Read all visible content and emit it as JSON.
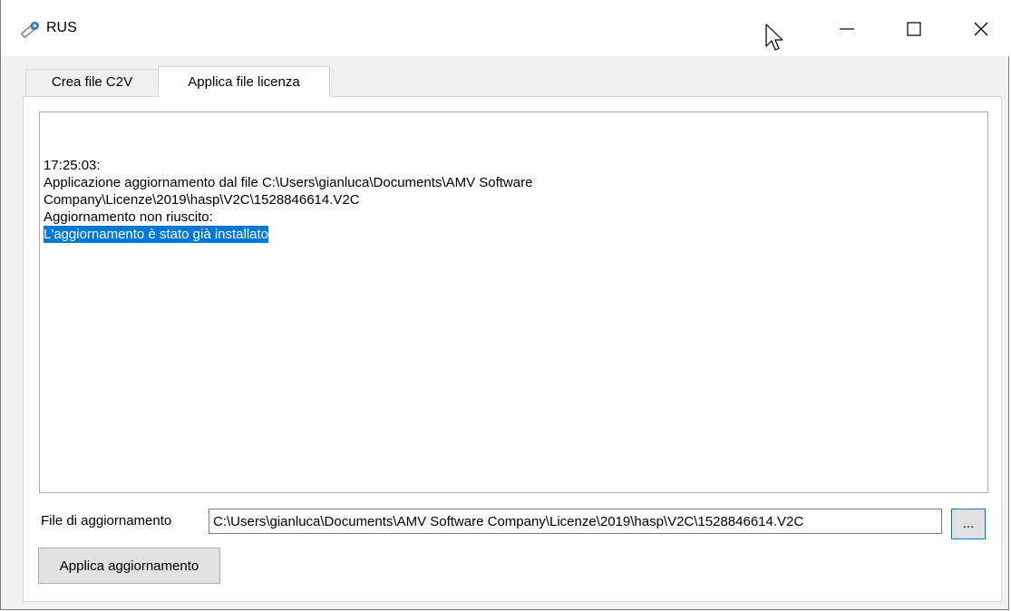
{
  "window": {
    "title": "RUS",
    "icon": "key-icon"
  },
  "tabs": [
    {
      "label": "Crea file C2V",
      "active": false
    },
    {
      "label": "Applica file licenza",
      "active": true
    }
  ],
  "log": {
    "timestamp": "17:25:03:",
    "line_1": "Applicazione aggiornamento dal file C:\\Users\\gianluca\\Documents\\AMV Software",
    "line_2": "Company\\Licenze\\2019\\hasp\\V2C\\1528846614.V2C",
    "line_3": "Aggiornamento non riuscito:",
    "selected_line": "L'aggiornamento è stato già installato"
  },
  "file": {
    "label": "File di aggiornamento",
    "value": "C:\\Users\\gianluca\\Documents\\AMV Software Company\\Licenze\\2019\\hasp\\V2C\\1528846614.V2C",
    "browse_label": "..."
  },
  "actions": {
    "apply_label": "Applica aggiornamento"
  },
  "colors": {
    "selection": "#0078d7",
    "window_bg": "#f0f0f0"
  }
}
